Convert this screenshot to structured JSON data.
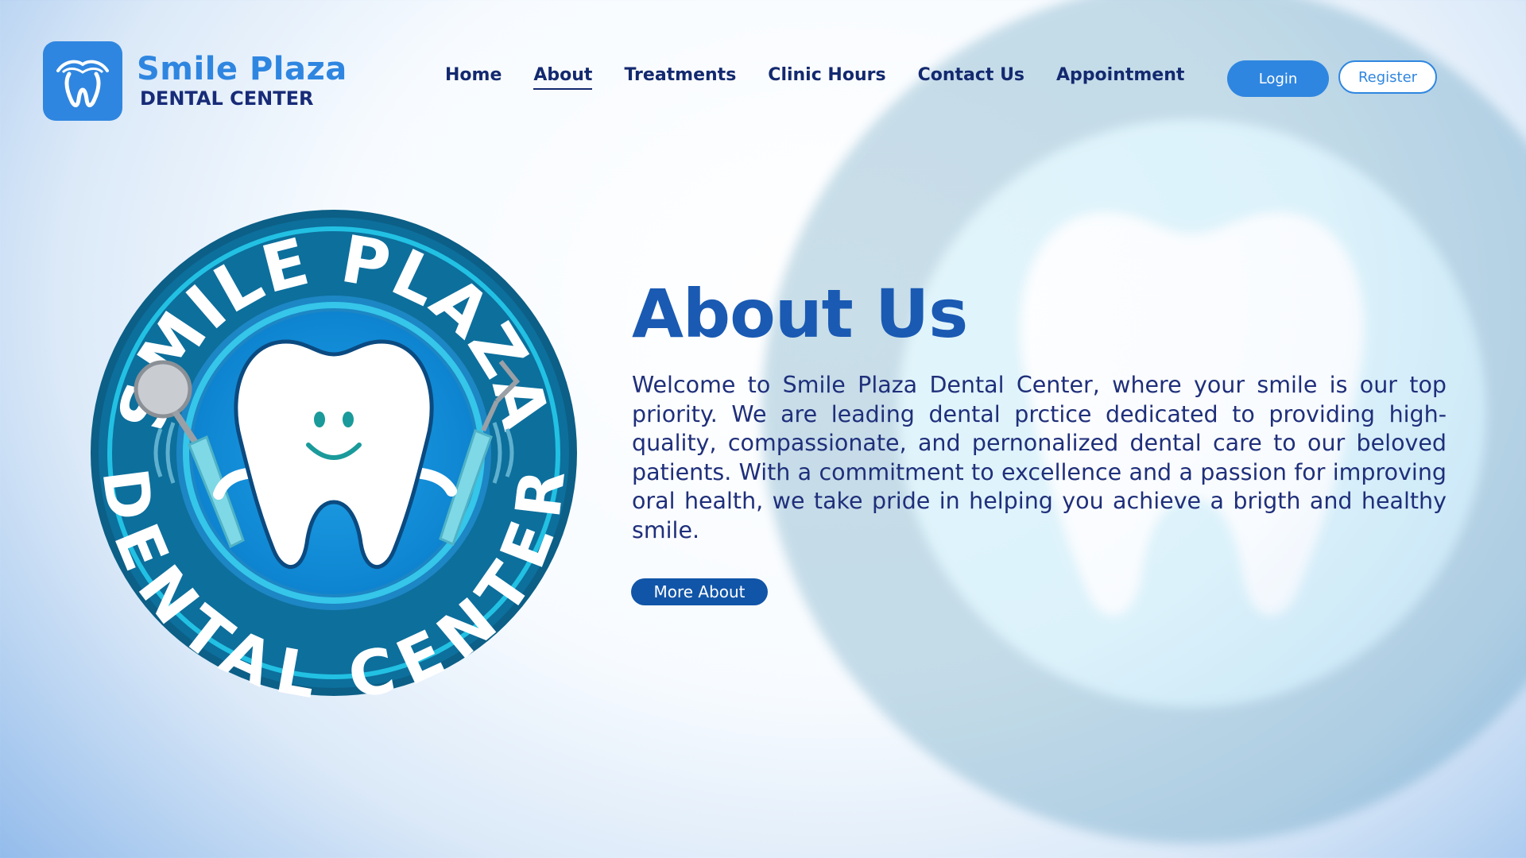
{
  "brand": {
    "name": "Smile Plaza",
    "subtitle": "DENTAL CENTER",
    "logo_icon": "tooth-icon",
    "accent": "#2f86e0",
    "navy": "#13296f"
  },
  "nav": {
    "items": [
      {
        "label": "Home",
        "active": false
      },
      {
        "label": "About",
        "active": true
      },
      {
        "label": "Treatments",
        "active": false
      },
      {
        "label": "Clinic Hours",
        "active": false
      },
      {
        "label": "Contact Us",
        "active": false
      },
      {
        "label": "Appointment",
        "active": false
      }
    ]
  },
  "auth": {
    "login_label": "Login",
    "register_label": "Register"
  },
  "seal": {
    "top_text": "SMILE PLAZA",
    "bottom_text": "DENTAL CENTER"
  },
  "about": {
    "title": "About Us",
    "body": "Welcome to Smile Plaza Dental Center, where your smile is our top priority. We are leading dental prctice dedicated to providing high-quality, compassionate, and pernonalized dental care to our beloved patients. With a commitment to excellence and a passion for improving oral health, we take pride in helping you achieve a brigth and healthy smile.",
    "button_label": "More About"
  }
}
